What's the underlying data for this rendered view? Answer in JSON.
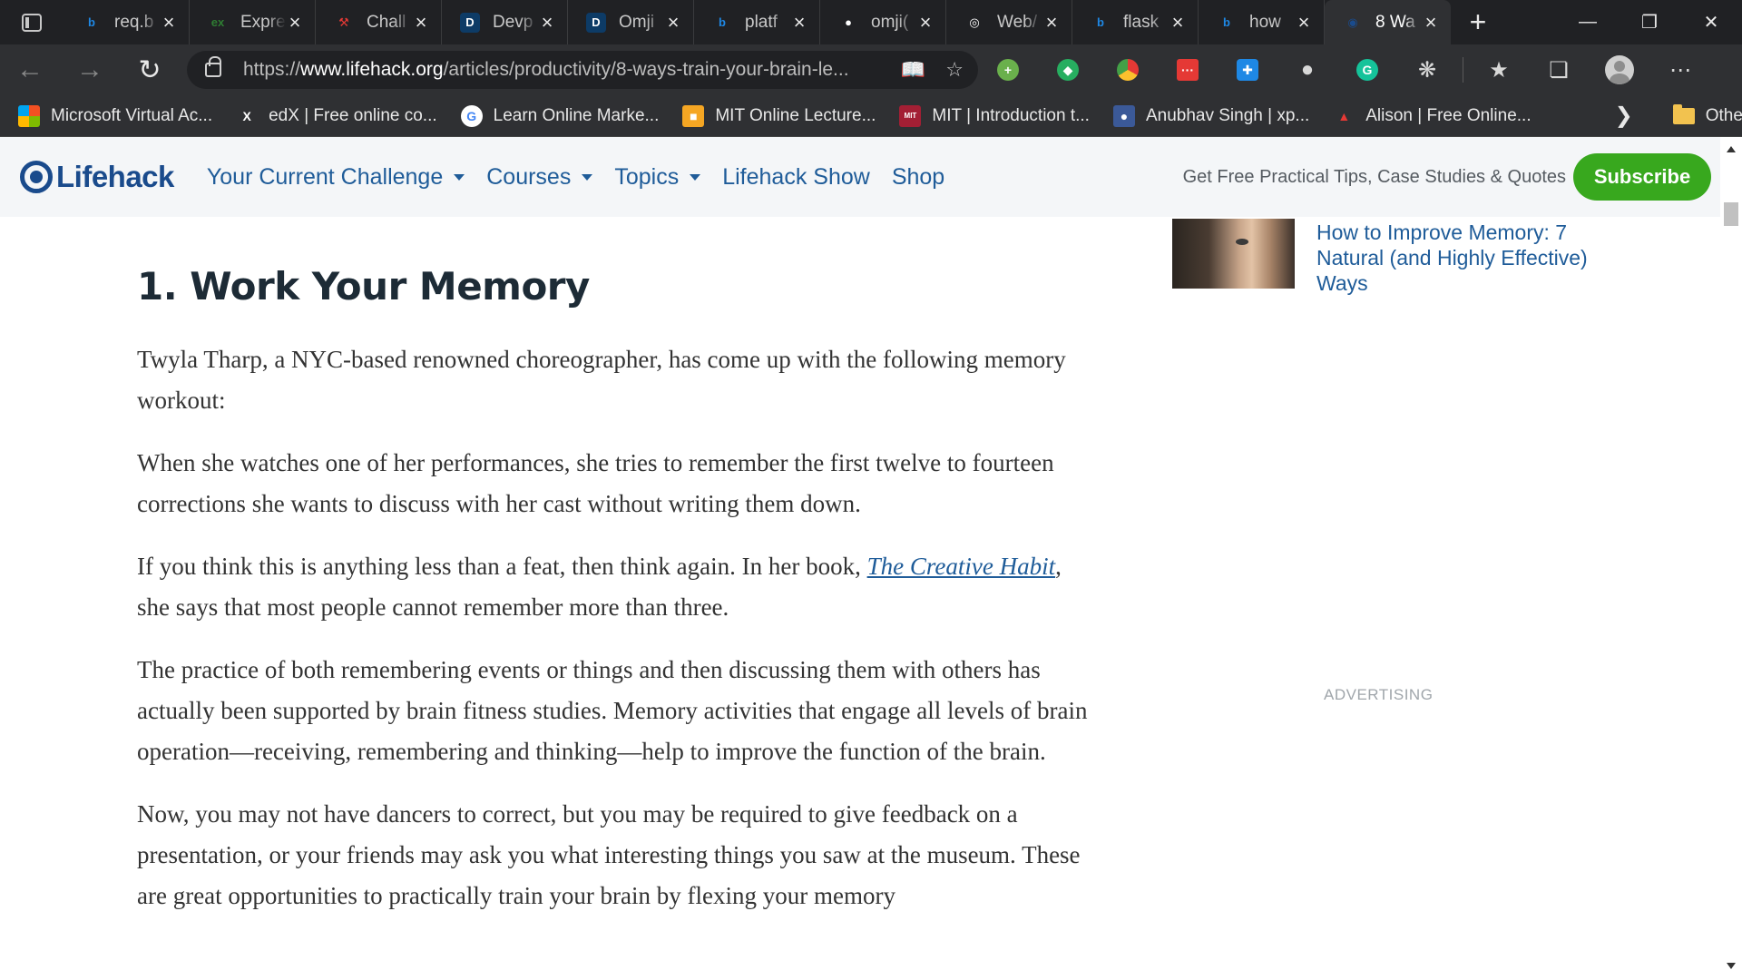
{
  "browser": {
    "tabs": [
      {
        "title": "req.b",
        "icon": "bing-icon",
        "color": "#1e88e5",
        "active": false
      },
      {
        "title": "Expre",
        "icon": "expressjs-icon",
        "color": "#2e7d32",
        "active": false
      },
      {
        "title": "Chall",
        "icon": "challenge-icon",
        "color": "#e53935",
        "active": false
      },
      {
        "title": "Devp",
        "icon": "devpost-icon",
        "color": "#0d3b66",
        "active": false
      },
      {
        "title": "Omji",
        "icon": "devpost-icon",
        "color": "#0d3b66",
        "active": false
      },
      {
        "title": "platf",
        "icon": "bing-icon",
        "color": "#1e88e5",
        "active": false
      },
      {
        "title": "omji(",
        "icon": "github-icon",
        "color": "#ffffff",
        "active": false
      },
      {
        "title": "Web/",
        "icon": "webflow-icon",
        "color": "#ffffff",
        "active": false
      },
      {
        "title": "flask",
        "icon": "bing-icon",
        "color": "#1e88e5",
        "active": false
      },
      {
        "title": "how",
        "icon": "bing-icon",
        "color": "#1e88e5",
        "active": false
      },
      {
        "title": "8 Wa",
        "icon": "lifehack-icon",
        "color": "#1a4b8c",
        "active": true
      }
    ],
    "new_tab": "+",
    "url": {
      "prefix": "https://",
      "domain": "www.lifehack.org",
      "path": "/articles/productivity/8-ways-train-your-brain-le..."
    },
    "favorites": [
      {
        "label": "Microsoft Virtual Ac...",
        "icon": "microsoft-icon"
      },
      {
        "label": "edX | Free online co...",
        "icon": "edx-icon"
      },
      {
        "label": "Learn Online Marke...",
        "icon": "google-icon"
      },
      {
        "label": "MIT Online Lecture...",
        "icon": "mit-lecture-icon"
      },
      {
        "label": "MIT | Introduction t...",
        "icon": "mit-ocw-icon"
      },
      {
        "label": "Anubhav Singh | xp...",
        "icon": "profile-photo-icon"
      },
      {
        "label": "Alison | Free Online...",
        "icon": "alison-icon"
      }
    ],
    "other_favorites": "Other favorites"
  },
  "site": {
    "logo": "Lifehack",
    "nav": [
      {
        "label": "Your Current Challenge",
        "dropdown": true
      },
      {
        "label": "Courses",
        "dropdown": true
      },
      {
        "label": "Topics",
        "dropdown": true
      },
      {
        "label": "Lifehack Show",
        "dropdown": false
      },
      {
        "label": "Shop",
        "dropdown": false
      }
    ],
    "tagline": "Get Free Practical Tips, Case Studies & Quotes",
    "subscribe": "Subscribe",
    "brand_color": "#1a4b8c",
    "accent_green": "#38a81e"
  },
  "article": {
    "heading": "1. Work Your Memory",
    "p1": "Twyla Tharp, a NYC-based renowned choreographer, has come up with the following memory workout:",
    "p2": "When she watches one of her performances, she tries to remember the first twelve to fourteen corrections she wants to discuss with her cast without writing them down.",
    "p3_before": "If you think this is anything less than a feat, then think again. In her book, ",
    "p3_link": "The Creative Habit",
    "p3_after": ", she says that most people cannot remember more than three.",
    "p4": "The practice of both remembering events or things and then discussing them with others has actually been supported by brain fitness studies. Memory activities that engage all levels of brain operation—receiving, remembering and thinking—help to improve the function of the brain.",
    "p5": "Now, you may not have dancers to correct, but you may be required to give feedback on a presentation, or your friends may ask you what interesting things you saw at the museum. These are great opportunities to practically train your brain by flexing your memory"
  },
  "sidebar": {
    "related_title": "How to Improve Memory: 7 Natural (and Highly Effective) Ways",
    "advertising": "ADVERTISING"
  }
}
